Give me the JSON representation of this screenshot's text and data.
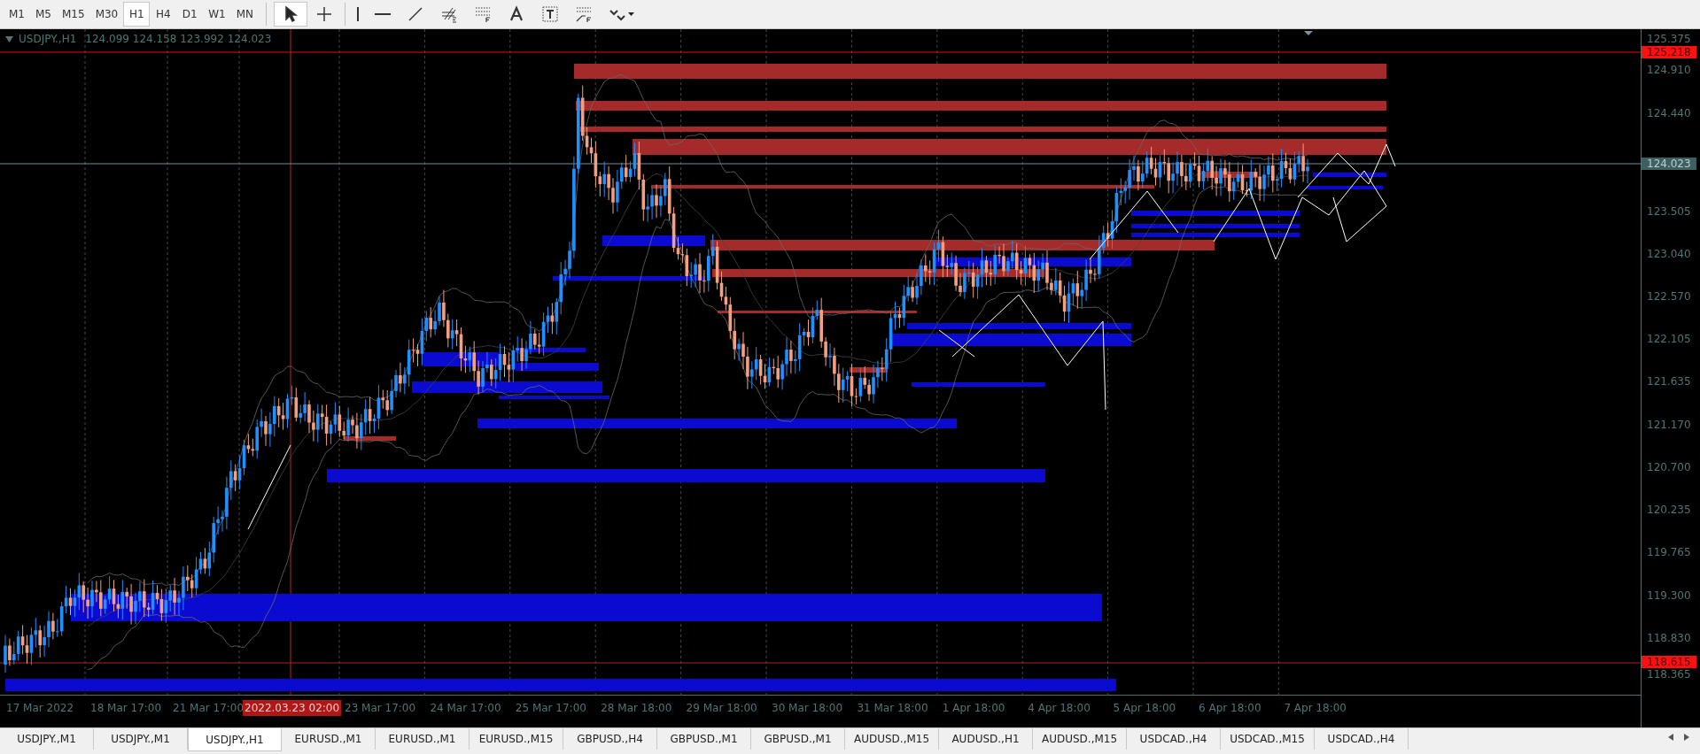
{
  "toolbar": {
    "timeframes": [
      {
        "label": "M1",
        "selected": false
      },
      {
        "label": "M5",
        "selected": false
      },
      {
        "label": "M15",
        "selected": false
      },
      {
        "label": "M30",
        "selected": false
      },
      {
        "label": "H1",
        "selected": true
      },
      {
        "label": "H4",
        "selected": false
      },
      {
        "label": "D1",
        "selected": false
      },
      {
        "label": "W1",
        "selected": false
      },
      {
        "label": "MN",
        "selected": false
      }
    ],
    "tools": [
      {
        "kind": "cursor",
        "selected": true
      },
      {
        "kind": "crosshair",
        "selected": false
      },
      {
        "kind": "vline",
        "selected": false
      },
      {
        "kind": "hline",
        "selected": false
      },
      {
        "kind": "trend",
        "selected": false
      },
      {
        "kind": "fibo-e",
        "selected": false
      },
      {
        "kind": "fibo-f",
        "selected": false
      },
      {
        "kind": "text",
        "selected": false
      },
      {
        "kind": "label",
        "selected": false
      },
      {
        "kind": "fan",
        "selected": false
      },
      {
        "kind": "shapes",
        "selected": false
      }
    ]
  },
  "chart": {
    "symbol": "USDJPY.,H1",
    "ohlc": "124.099 124.158 123.992 124.023",
    "price_ticks": [
      "125.375",
      "124.910",
      "124.440",
      "123.505",
      "123.040",
      "122.570",
      "122.105",
      "121.635",
      "121.170",
      "120.700",
      "120.235",
      "119.765",
      "119.300",
      "118.830",
      "118.365"
    ],
    "price_markers": [
      {
        "text": "125.218",
        "kind": "alert"
      },
      {
        "text": "124.023",
        "kind": "bid"
      },
      {
        "text": "118.615",
        "kind": "alert"
      }
    ],
    "time_labels": [
      {
        "text": "17 Mar 2022",
        "selected": false
      },
      {
        "text": "18 Mar 17:00",
        "selected": false
      },
      {
        "text": "21 Mar 17:00",
        "selected": false
      },
      {
        "text": "2022.03.23 02:00",
        "selected": true
      },
      {
        "text": "23 Mar 17:00",
        "selected": false
      },
      {
        "text": "24 Mar 17:00",
        "selected": false
      },
      {
        "text": "25 Mar 17:00",
        "selected": false
      },
      {
        "text": "28 Mar 18:00",
        "selected": false
      },
      {
        "text": "29 Mar 18:00",
        "selected": false
      },
      {
        "text": "30 Mar 18:00",
        "selected": false
      },
      {
        "text": "31 Mar 18:00",
        "selected": false
      },
      {
        "text": "1 Apr 18:00",
        "selected": false
      },
      {
        "text": "4 Apr 18:00",
        "selected": false
      },
      {
        "text": "5 Apr 18:00",
        "selected": false
      },
      {
        "text": "6 Apr 18:00",
        "selected": false
      },
      {
        "text": "7 Apr 18:00",
        "selected": false
      }
    ]
  },
  "tabs": [
    {
      "label": "USDJPY.,M1",
      "selected": false
    },
    {
      "label": "USDJPY.,M1",
      "selected": false
    },
    {
      "label": "USDJPY.,H1",
      "selected": true
    },
    {
      "label": "EURUSD.,M1",
      "selected": false
    },
    {
      "label": "EURUSD.,M1",
      "selected": false
    },
    {
      "label": "EURUSD.,M15",
      "selected": false
    },
    {
      "label": "GBPUSD.,H4",
      "selected": false
    },
    {
      "label": "GBPUSD.,M1",
      "selected": false
    },
    {
      "label": "GBPUSD.,M1",
      "selected": false
    },
    {
      "label": "AUDUSD.,M15",
      "selected": false
    },
    {
      "label": "AUDUSD.,H1",
      "selected": false
    },
    {
      "label": "AUDUSD.,M15",
      "selected": false
    },
    {
      "label": "USDCAD.,H4",
      "selected": false
    },
    {
      "label": "USDCAD.,M15",
      "selected": false
    },
    {
      "label": "USDCAD.,H4",
      "selected": false
    }
  ]
}
